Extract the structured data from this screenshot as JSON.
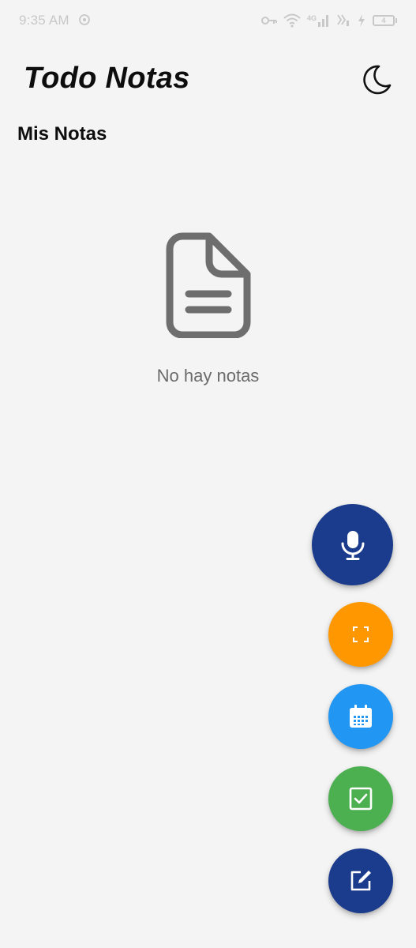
{
  "status_bar": {
    "time": "9:35 AM",
    "network_label": "4G",
    "battery_level": "4"
  },
  "header": {
    "title": "Todo Notas",
    "theme_icon": "moon-icon"
  },
  "section": {
    "title": "Mis Notas"
  },
  "empty_state": {
    "icon": "document-icon",
    "message": "No hay notas"
  },
  "fabs": [
    {
      "icon": "microphone-icon",
      "color": "#1b3c8c"
    },
    {
      "icon": "scan-icon",
      "color": "#ff9800"
    },
    {
      "icon": "calendar-icon",
      "color": "#2196f3"
    },
    {
      "icon": "checkbox-icon",
      "color": "#4caf50"
    },
    {
      "icon": "edit-icon",
      "color": "#1b3c8c"
    }
  ]
}
